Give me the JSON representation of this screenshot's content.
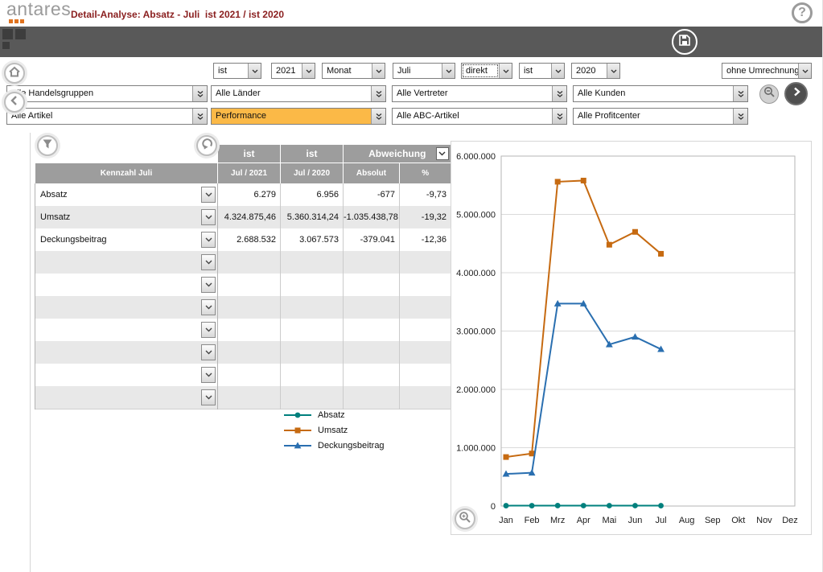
{
  "app": {
    "logo_text": "antares",
    "title": "Detail-Analyse: Absatz - Juli  ist 2021 / ist 2020",
    "title_color": "#8a1f1f",
    "help": "?"
  },
  "filters": {
    "highlight_color": "#fbb947",
    "row1": [
      {
        "value": "ist"
      },
      {
        "value": "2021"
      },
      {
        "value": "Monat"
      },
      {
        "value": "Juli"
      },
      {
        "value": "direkt"
      },
      {
        "value": "ist"
      },
      {
        "value": "2020"
      },
      {
        "value": "ohne Umrechnung"
      }
    ],
    "row2": [
      {
        "value": "Alle Handelsgruppen"
      },
      {
        "value": "Alle Länder"
      },
      {
        "value": "Alle Vertreter"
      },
      {
        "value": "Alle Kunden"
      }
    ],
    "row3": [
      {
        "value": "Alle Artikel"
      },
      {
        "value": "Performance"
      },
      {
        "value": "Alle ABC-Artikel"
      },
      {
        "value": "Alle Profitcenter"
      }
    ]
  },
  "table": {
    "header": {
      "kennzahl": "Kennzahl Juli",
      "col1_top": "ist",
      "col1_sub": "Jul / 2021",
      "col2_top": "ist",
      "col2_sub": "Jul / 2020",
      "abweichung": "Abweichung",
      "absolut": "Absolut",
      "percent": "%"
    },
    "rows": [
      {
        "label": "Absatz",
        "ist2021": "6.279",
        "ist2020": "6.956",
        "absolut": "-677",
        "percent": "-9,73"
      },
      {
        "label": "Umsatz",
        "ist2021": "4.324.875,46",
        "ist2020": "5.360.314,24",
        "absolut": "-1.035.438,78",
        "percent": "-19,32"
      },
      {
        "label": "Deckungsbeitrag",
        "ist2021": "2.688.532",
        "ist2020": "3.067.573",
        "absolut": "-379.041",
        "percent": "-12,36"
      },
      {
        "label": "",
        "ist2021": "",
        "ist2020": "",
        "absolut": "",
        "percent": ""
      },
      {
        "label": "",
        "ist2021": "",
        "ist2020": "",
        "absolut": "",
        "percent": ""
      },
      {
        "label": "",
        "ist2021": "",
        "ist2020": "",
        "absolut": "",
        "percent": ""
      },
      {
        "label": "",
        "ist2021": "",
        "ist2020": "",
        "absolut": "",
        "percent": ""
      },
      {
        "label": "",
        "ist2021": "",
        "ist2020": "",
        "absolut": "",
        "percent": ""
      },
      {
        "label": "",
        "ist2021": "",
        "ist2020": "",
        "absolut": "",
        "percent": ""
      },
      {
        "label": "",
        "ist2021": "",
        "ist2020": "",
        "absolut": "",
        "percent": ""
      }
    ]
  },
  "chart_data": {
    "type": "line",
    "title": "",
    "xlabel": "",
    "ylabel": "",
    "grid": "horizontal",
    "legend_position": "left-of-chart",
    "categories": [
      "Jan",
      "Feb",
      "Mrz",
      "Apr",
      "Mai",
      "Jun",
      "Jul",
      "Aug",
      "Sep",
      "Okt",
      "Nov",
      "Dez"
    ],
    "ylim": [
      0,
      6000000
    ],
    "y_ticks": [
      {
        "value": 0,
        "label": "0"
      },
      {
        "value": 1000000,
        "label": "1.000.000"
      },
      {
        "value": 2000000,
        "label": "2.000.000"
      },
      {
        "value": 3000000,
        "label": "3.000.000"
      },
      {
        "value": 4000000,
        "label": "4.000.000"
      },
      {
        "value": 5000000,
        "label": "5.000.000"
      },
      {
        "value": 6000000,
        "label": "6.000.000"
      }
    ],
    "series": [
      {
        "name": "Absatz",
        "color": "#00807d",
        "marker": "circle",
        "values": [
          6000,
          6200,
          7500,
          7400,
          6900,
          7000,
          6279
        ]
      },
      {
        "name": "Umsatz",
        "color": "#c66a11",
        "marker": "square",
        "values": [
          840000,
          900000,
          5560000,
          5580000,
          4480000,
          4700000,
          4324875
        ]
      },
      {
        "name": "Deckungsbeitrag",
        "color": "#2a6fb0",
        "marker": "triangle",
        "values": [
          550000,
          570000,
          3470000,
          3470000,
          2770000,
          2900000,
          2688532
        ]
      }
    ]
  }
}
